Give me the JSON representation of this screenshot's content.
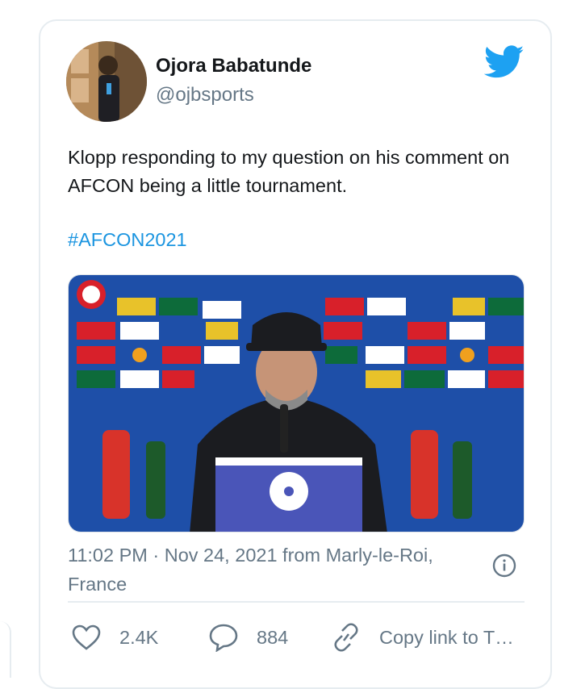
{
  "author": {
    "name": "Ojora Babatunde",
    "handle": "@ojbsports",
    "avatar_icon": "profile-photo"
  },
  "brand_icon": "twitter-bird-icon",
  "brand_color": "#1da1f2",
  "tweet": {
    "text": "Klopp responding to my question on his comment on AFCON being a little tournament.",
    "hashtag": "#AFCON2021"
  },
  "media": {
    "description_icon": "press-conference-video"
  },
  "meta": {
    "timestamp": "11:02 PM · Nov 24, 2021 from Marly-le-Roi, France"
  },
  "actions": {
    "likes": "2.4K",
    "replies": "884",
    "copy_link": "Copy link to T…"
  },
  "colors": {
    "text": "#14171a",
    "secondary": "#657786",
    "link": "#1b95e0",
    "border": "#e6ecf0"
  }
}
